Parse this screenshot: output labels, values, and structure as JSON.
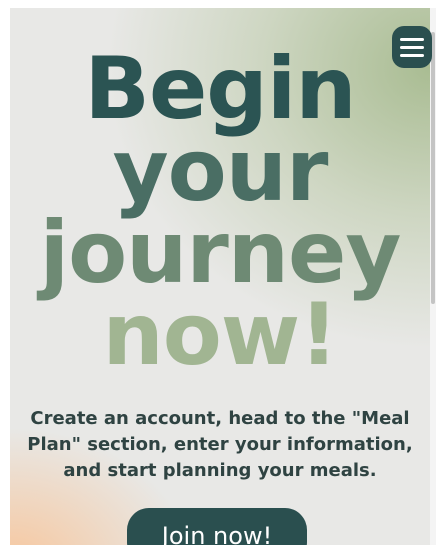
{
  "hero": {
    "title_words": [
      "Begin",
      "your",
      "journey",
      "now!"
    ],
    "description": "Create an account, head to the \"Meal Plan\" section, enter your information, and start planning your meals.",
    "cta_label": "Join now!"
  },
  "nav": {
    "menu_icon": "hamburger-menu-icon"
  },
  "colors": {
    "primary": "#2a4f4f",
    "title_top": "#2b5453",
    "title_bottom": "#a1b592",
    "text": "#2f4342",
    "accent_green": "#a6ba8e",
    "accent_peach": "#f8c498"
  }
}
